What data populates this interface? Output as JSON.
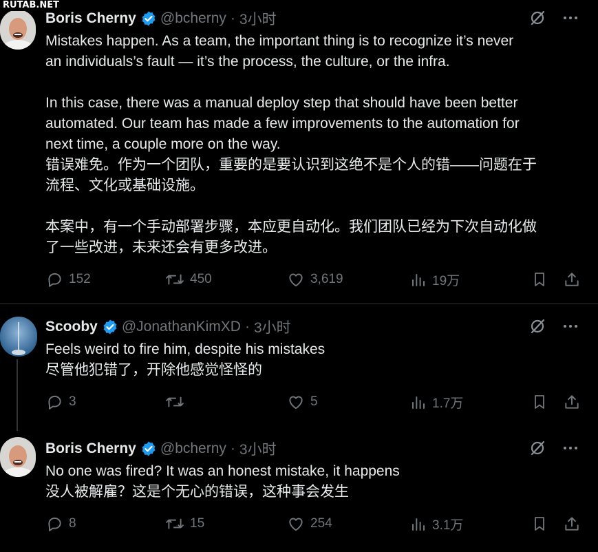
{
  "watermark": "RUTAB.NET",
  "tweets": [
    {
      "name": "Boris Cherny",
      "handle": "@bcherny",
      "separator": "·",
      "time": "3小时",
      "text_paragraphs": [
        "Mistakes happen. As a team, the important thing is to recognize it’s never\nan individuals’s fault — it’s the process, the culture, or the infra.",
        "In this case, there was a manual deploy step that should have been better\nautomated. Our team has made a few improvements to the automation for\nnext time, a couple more on the way.\n错误难免。作为一个团队，重要的是要认识到这绝不是个人的错——问题在于\n流程、文化或基础设施。",
        "本案中，有一个手动部署步骤，本应更自动化。我们团队已经为下次自动化做\n了一些改进，未来还会有更多改进。"
      ],
      "replies": "152",
      "reposts": "450",
      "likes": "3,619",
      "views": "19万"
    },
    {
      "name": "Scooby",
      "handle": "@JonathanKimXD",
      "separator": "·",
      "time": "3小时",
      "text_paragraphs": [
        "Feels weird to fire him, despite his mistakes\n尽管他犯错了，开除他感觉怪怪的"
      ],
      "replies": "3",
      "reposts": "",
      "likes": "5",
      "views": "1.7万"
    },
    {
      "name": "Boris Cherny",
      "handle": "@bcherny",
      "separator": "·",
      "time": "3小时",
      "text_paragraphs": [
        "No one was fired? It was an honest mistake, it happens\n没人被解雇？这是个无心的错误，这种事会发生"
      ],
      "replies": "8",
      "reposts": "15",
      "likes": "254",
      "views": "3.1万"
    }
  ],
  "colors": {
    "background": "#000000",
    "text": "#e7e9ea",
    "muted": "#71767b",
    "verified": "#1d9bf0",
    "divider": "#2f3336"
  }
}
